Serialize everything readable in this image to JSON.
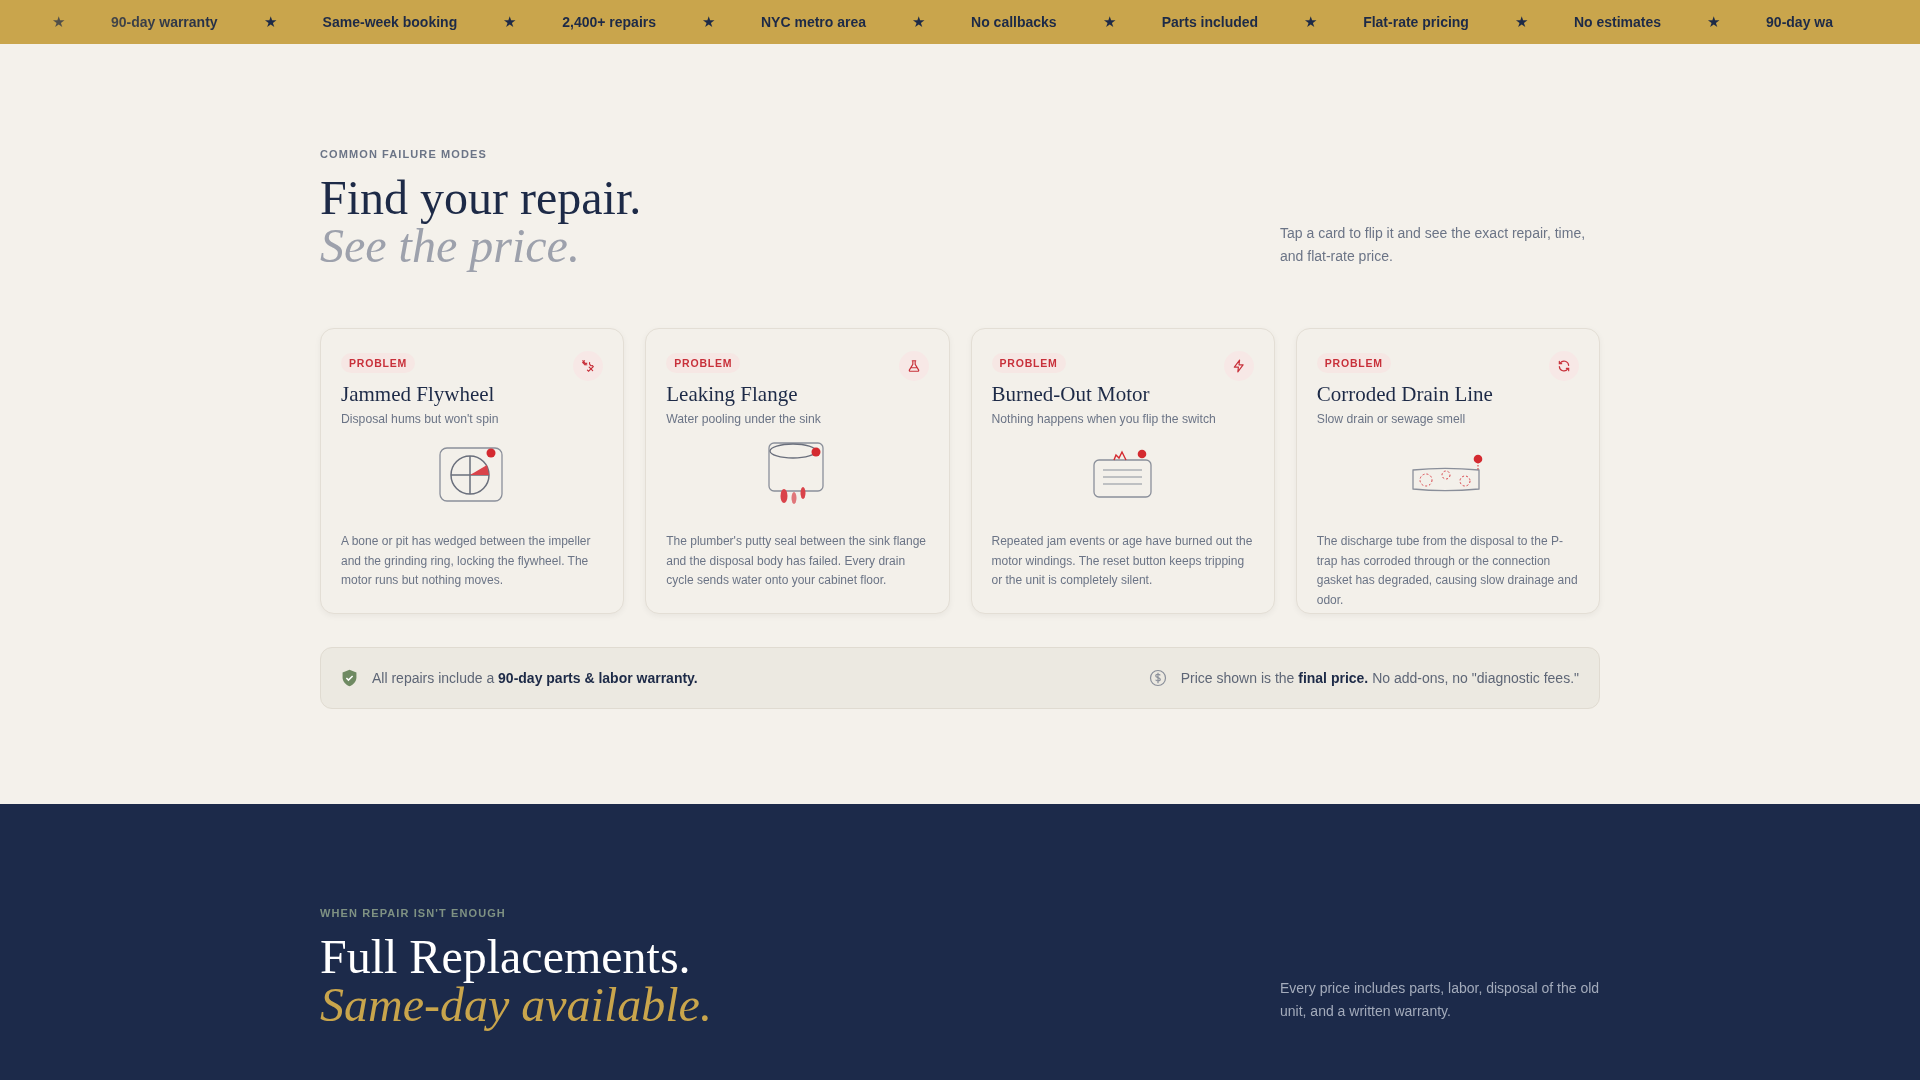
{
  "ticker": [
    {
      "star": "★",
      "label": "90-day warranty"
    },
    {
      "star": "★",
      "label": "Same-week booking"
    },
    {
      "star": "★",
      "label": "2,400+ repairs"
    },
    {
      "star": "★",
      "label": "NYC metro area"
    },
    {
      "star": "★",
      "label": "No callbacks"
    },
    {
      "star": "★",
      "label": "Parts included"
    },
    {
      "star": "★",
      "label": "Flat-rate pricing"
    },
    {
      "star": "★",
      "label": "No estimates"
    },
    {
      "star": "★",
      "label": "90-day wa"
    }
  ],
  "failures": {
    "eyebrow": "COMMON FAILURE MODES",
    "title": "Find your repair.",
    "subtitle": "See the price.",
    "intro": "Tap a card to flip it and see the exact repair, time, and flat-rate price.",
    "cards": [
      {
        "kind": "flywheel",
        "tag": "PROBLEM",
        "title": "Jammed Flywheel",
        "symptom": "Disposal hums but won't spin",
        "description": "A bone or pit has wedged between the impeller and the grinding ring, locking the flywheel. The motor runs but nothing moves."
      },
      {
        "kind": "flange",
        "tag": "PROBLEM",
        "title": "Leaking Flange",
        "symptom": "Water pooling under the sink",
        "description": "The plumber's putty seal between the sink flange and the disposal body has failed. Every drain cycle sends water onto your cabinet floor."
      },
      {
        "kind": "motor",
        "tag": "PROBLEM",
        "title": "Burned-Out Motor",
        "symptom": "Nothing happens when you flip the switch",
        "description": "Repeated jam events or age have burned out the motor windings. The reset button keeps tripping or the unit is completely silent."
      },
      {
        "kind": "drain",
        "tag": "PROBLEM",
        "title": "Corroded Drain Line",
        "symptom": "Slow drain or sewage smell",
        "description": "The discharge tube from the disposal to the P-trap has corroded through or the connection gasket has degraded, causing slow drainage and odor."
      }
    ],
    "notes": [
      {
        "kind": "warranty",
        "text": "All repairs include a **90-day parts & labor warranty.**"
      },
      {
        "kind": "price",
        "text": "Price shown is the **final price.** No add-ons, no \"diagnostic fees.\""
      }
    ]
  },
  "replacements": {
    "eyebrow": "WHEN REPAIR ISN'T ENOUGH",
    "title": "Full Replacements.",
    "subtitle": "Same-day available.",
    "intro": "Every price includes parts, labor, disposal of the old unit, and a written warranty."
  }
}
